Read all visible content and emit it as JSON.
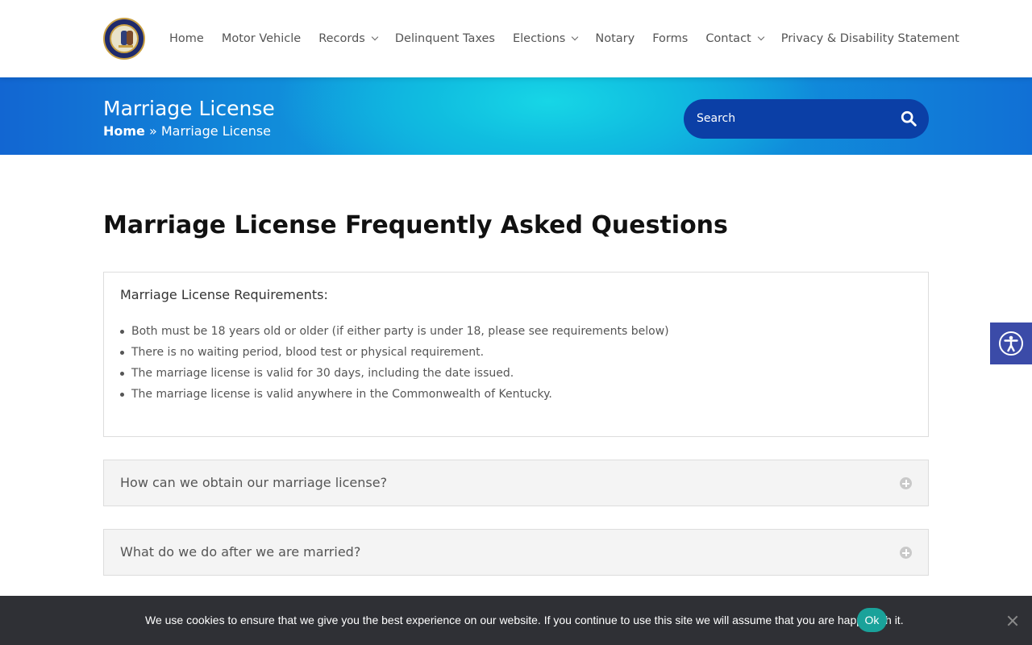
{
  "header": {
    "logo_icon": "county-seal-icon",
    "nav": [
      {
        "label": "Home",
        "dropdown": false
      },
      {
        "label": "Motor Vehicle",
        "dropdown": false
      },
      {
        "label": "Records",
        "dropdown": true
      },
      {
        "label": "Delinquent Taxes",
        "dropdown": false
      },
      {
        "label": "Elections",
        "dropdown": true
      },
      {
        "label": "Notary",
        "dropdown": false
      },
      {
        "label": "Forms",
        "dropdown": false
      },
      {
        "label": "Contact",
        "dropdown": true
      },
      {
        "label": "Privacy & Disability Statement",
        "dropdown": false
      }
    ]
  },
  "banner": {
    "title": "Marriage License",
    "breadcrumb": {
      "home": "Home",
      "separator": " » ",
      "current": "Marriage License"
    },
    "search": {
      "placeholder": "Search",
      "icon": "search-icon"
    }
  },
  "main": {
    "heading": "Marriage License Frequently Asked Questions",
    "requirements": {
      "title": "Marriage License Requirements:",
      "items": [
        "Both must be 18 years old or older (if either party is under 18, please see requirements below)",
        "There is no waiting period, blood test or physical requirement.",
        "The marriage license is valid for 30 days, including the date issued.",
        "The marriage license is valid anywhere in the Commonwealth of Kentucky."
      ]
    },
    "faqs": [
      {
        "question": "How can we obtain our marriage license?"
      },
      {
        "question": "What do we do after we are married?"
      }
    ]
  },
  "accessibility": {
    "icon": "accessibility-icon"
  },
  "cookie": {
    "text": "We use cookies to ensure that we give you the best experience on our website. If you continue to use this site we will assume that you are happy with it.",
    "ok_label": "Ok"
  },
  "colors": {
    "banner_start": "#1266d2",
    "banner_glow": "#17d6e6",
    "search_bg": "#0b3fa6",
    "accessibility_bg": "#3b4ba8",
    "cookie_bg": "#2f3035",
    "cookie_ok": "#1aa29a"
  }
}
